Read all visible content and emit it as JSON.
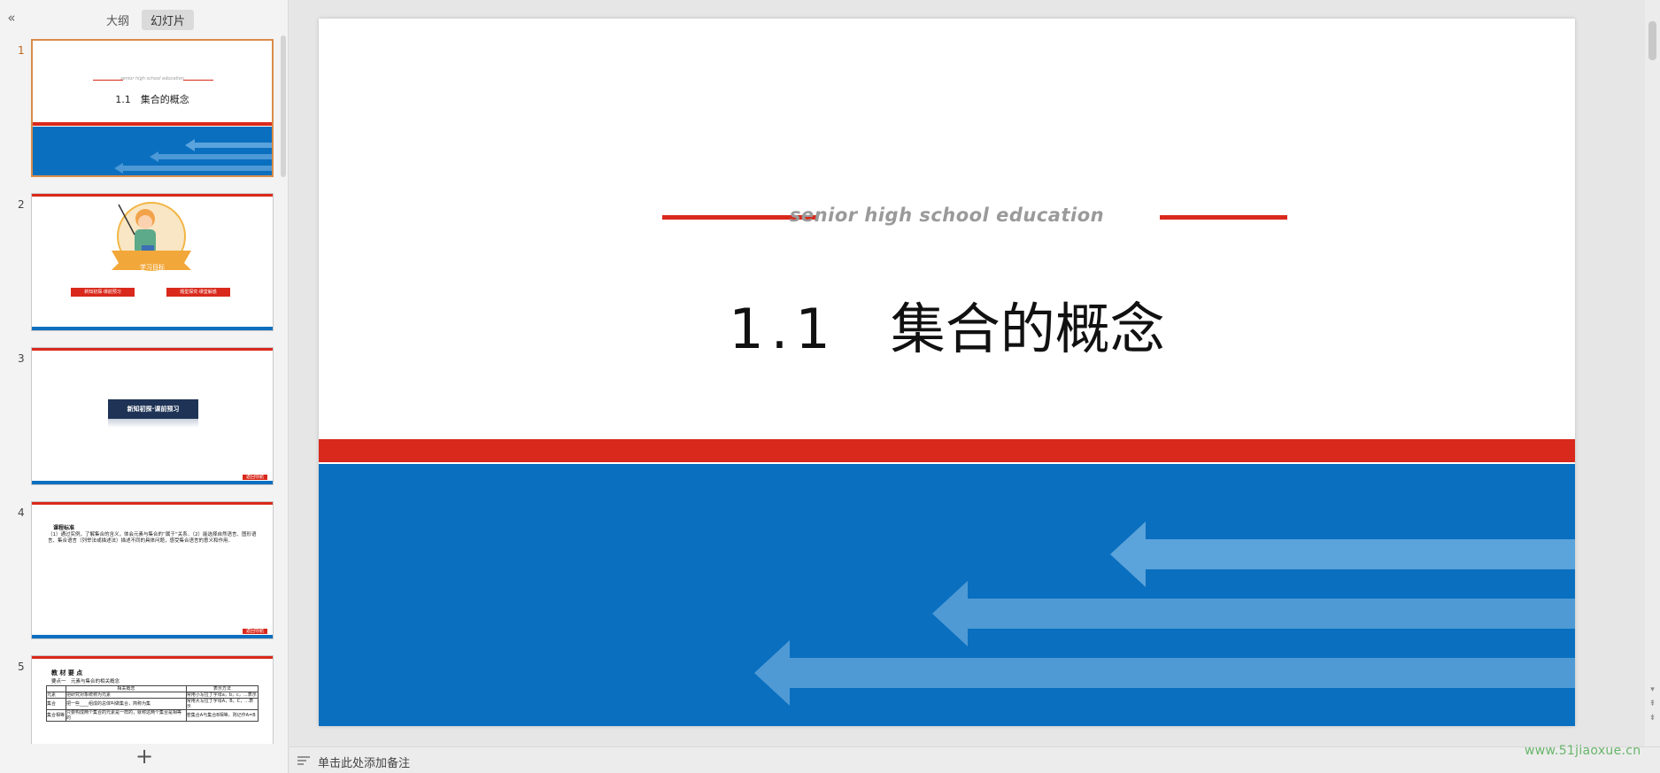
{
  "left_panel": {
    "tabs": [
      {
        "label": "大纲",
        "active": false
      },
      {
        "label": "幻灯片",
        "active": true
      }
    ],
    "slides": [
      {
        "number": "1",
        "active": true,
        "subtitle": "senior high school education",
        "title": "1.1　集合的概念"
      },
      {
        "number": "2",
        "active": false,
        "banner": "学习目标",
        "buttons": [
          "新知初探·课前预习",
          "题型探究·课堂解惑"
        ]
      },
      {
        "number": "3",
        "active": false,
        "header_box": "新知初探·课前预习",
        "badge": "返回导航"
      },
      {
        "number": "4",
        "active": false,
        "heading": "课程标准",
        "body": "（1）通过实例，了解集合的含义，体会元素与集合的“属于”关系．（2）能选择自然语言、图形语言、集合语言（列举法或描述法）描述不同的具体问题，感受集合语言的意义和作用．",
        "badge": "返回导航"
      },
      {
        "number": "5",
        "active": false,
        "heading": "教 材 要 点",
        "subheading": "要点一　元素与集合的相关概念",
        "table": {
          "headers": [
            "",
            "相关概念",
            "表示方法"
          ],
          "rows": [
            [
              "元素",
              "把研究对象统称为元素",
              "常用小写拉丁字母a，b，c，…表示"
            ],
            [
              "集合",
              "把一些____组成的总体叫做集合，简称为集",
              "常用大写拉丁字母A，B，C，…表示"
            ],
            [
              "集合相等",
              "只要构成两个集合的元素是一样的，就称这两个集合是相等的",
              "若集合A与集合B相等，则记作A=B"
            ]
          ]
        }
      }
    ],
    "add_slide_icon": "plus-icon"
  },
  "slide": {
    "subtitle": "senior high school education",
    "title_number": "1.1",
    "title_text": "集合的概念",
    "colors": {
      "accent_red": "#d9291c",
      "accent_blue": "#0a6fbf",
      "subtitle_gray": "#9a9a9a"
    }
  },
  "notes": {
    "placeholder": "单击此处添加备注"
  },
  "watermark": "www.51jiaoxue.cn"
}
